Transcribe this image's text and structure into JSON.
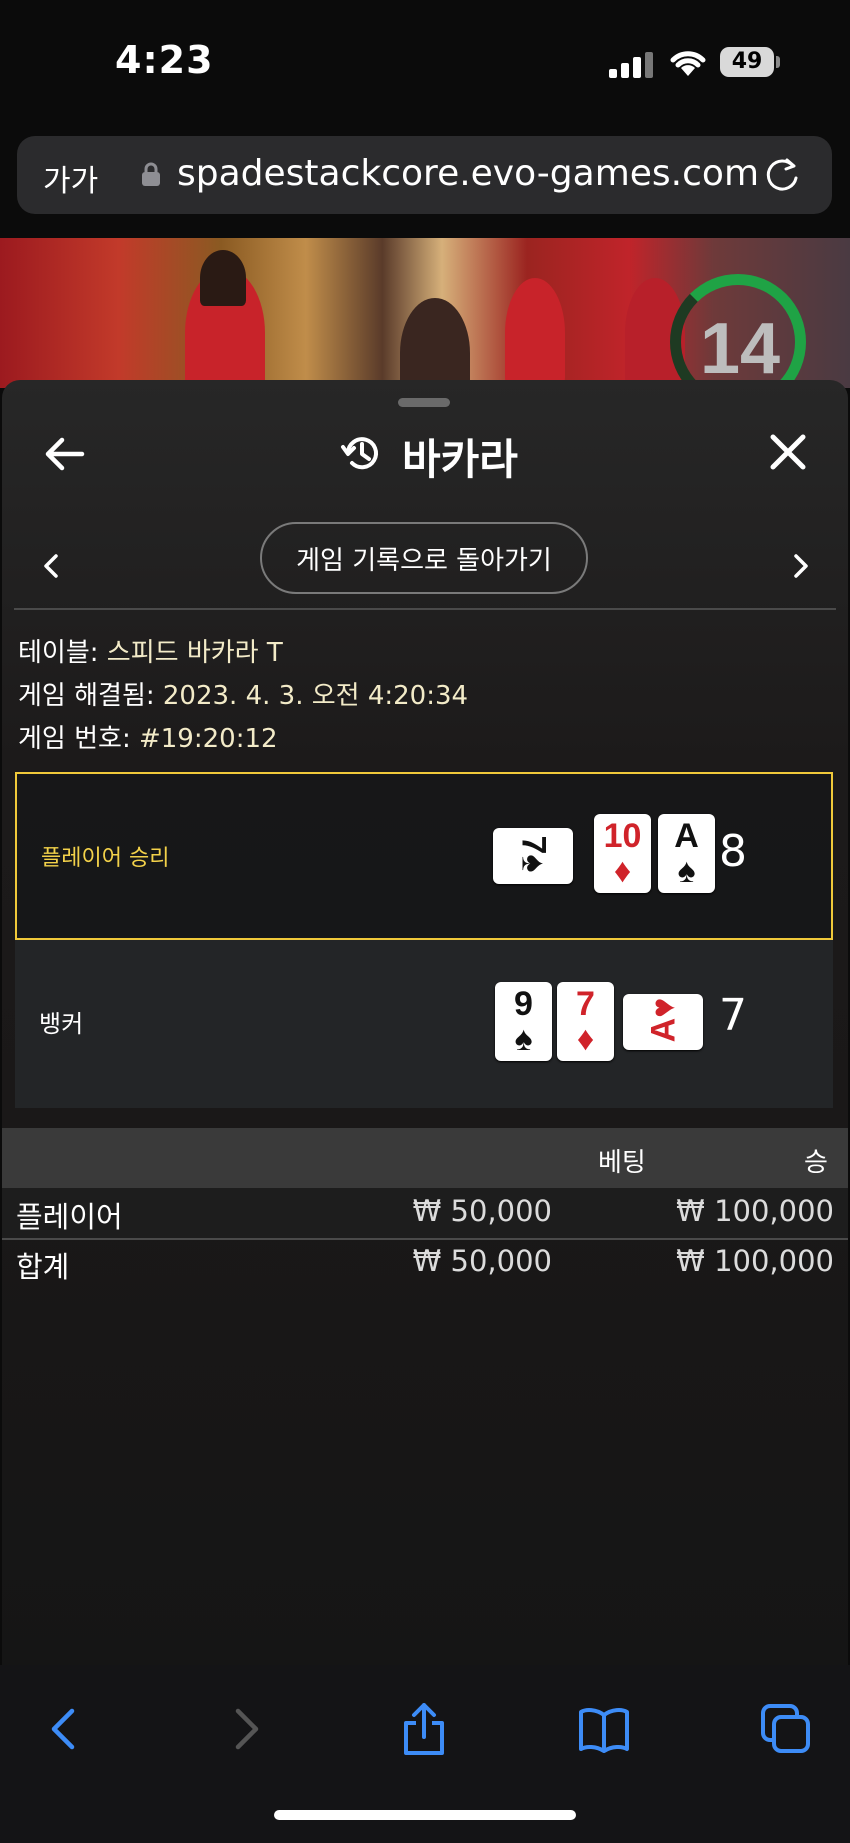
{
  "status_bar": {
    "time": "4:23",
    "battery": "49"
  },
  "browser": {
    "text_size_button": "가가",
    "url": "spadestackcore.evo-games.com"
  },
  "video": {
    "countdown": "14"
  },
  "panel": {
    "title": "바카라",
    "back_to_history_label": "게임 기록으로 돌아가기",
    "info": {
      "table_label": "테이블:",
      "table_value": "스피드 바카라 T",
      "resolved_label": "게임 해결됨:",
      "resolved_value": "2023. 4. 3. 오전 4:20:34",
      "game_no_label": "게임 번호:",
      "game_no_value": "#19:20:12"
    },
    "player": {
      "label": "플레이어 승리",
      "score": "8",
      "cards": [
        {
          "rank": "7",
          "suit": "♠",
          "color": "#111111",
          "orientation": "rotated"
        },
        {
          "rank": "10",
          "suit": "♦",
          "color": "#d0232a",
          "orientation": "upright"
        },
        {
          "rank": "A",
          "suit": "♠",
          "color": "#111111",
          "orientation": "upright"
        }
      ]
    },
    "banker": {
      "label": "뱅커",
      "score": "7",
      "cards": [
        {
          "rank": "9",
          "suit": "♠",
          "color": "#111111",
          "orientation": "upright"
        },
        {
          "rank": "7",
          "suit": "♦",
          "color": "#d0232a",
          "orientation": "upright"
        },
        {
          "rank": "A",
          "suit": "♥",
          "color": "#d0232a",
          "orientation": "rotated"
        }
      ]
    },
    "bets": {
      "headers": {
        "bet": "베팅",
        "win": "승"
      },
      "rows": [
        {
          "label": "플레이어",
          "bet": "₩ 50,000",
          "win": "₩ 100,000"
        },
        {
          "label": "합계",
          "bet": "₩ 50,000",
          "win": "₩ 100,000"
        }
      ]
    }
  },
  "colors": {
    "win_highlight": "#f0c93a",
    "timer_green": "#1fa345",
    "ios_blue": "#3d8cf7"
  }
}
